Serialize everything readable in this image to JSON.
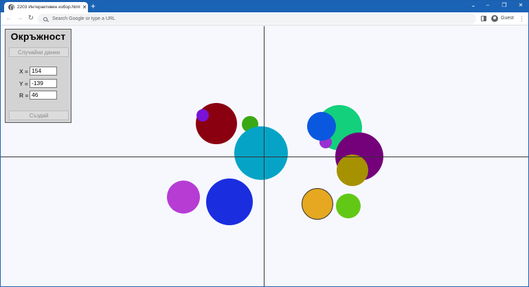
{
  "browser": {
    "tab_title": "2203 Интерактивен избор.html",
    "tab_close": "✕",
    "new_tab": "+",
    "window_controls": {
      "collapse": "⌄",
      "minimize": "–",
      "maximize": "❐",
      "close": "✕"
    },
    "nav": {
      "back": "←",
      "forward": "→",
      "reload": "↻"
    },
    "omnibox_placeholder": "Search Google or type a URL",
    "profile_label": "Guest",
    "menu": "⋮"
  },
  "panel": {
    "title": "Окръжност",
    "random_button": "Случайни данни",
    "x_label": "X =",
    "x_value": "154",
    "y_label": "Y =",
    "y_value": "-139",
    "r_label": "R =",
    "r_value": "46",
    "create_button": "Създай"
  },
  "scene": {
    "background": "#f7f8fe",
    "axis_color": "#333333",
    "circles": [
      {
        "name": "dark-red-circle",
        "color": "#8b0010",
        "outline": false
      },
      {
        "name": "violet-small-circle",
        "color": "#7a12d6",
        "outline": false
      },
      {
        "name": "green-small-circle",
        "color": "#3aa814",
        "outline": false
      },
      {
        "name": "cyan-circle",
        "color": "#05a4c6",
        "outline": false
      },
      {
        "name": "magenta-circle",
        "color": "#b63cd4",
        "outline": false
      },
      {
        "name": "blue-circle",
        "color": "#1a2ee0",
        "outline": false
      },
      {
        "name": "mint-green-circle",
        "color": "#13d07c",
        "outline": false
      },
      {
        "name": "purple-small-circle",
        "color": "#9a2fd2",
        "outline": false
      },
      {
        "name": "blue-medium-circle",
        "color": "#0a58e0",
        "outline": false
      },
      {
        "name": "purple-circle",
        "color": "#74007a",
        "outline": false
      },
      {
        "name": "olive-circle",
        "color": "#a69100",
        "outline": false
      },
      {
        "name": "orange-circle",
        "color": "#e6a820",
        "outline": true
      },
      {
        "name": "lime-circle",
        "color": "#62c816",
        "outline": false
      }
    ]
  }
}
